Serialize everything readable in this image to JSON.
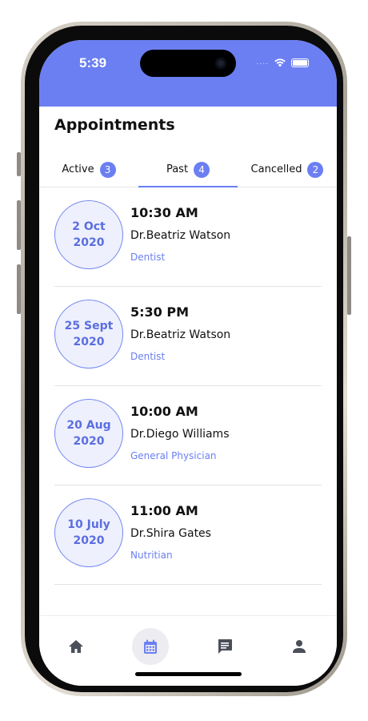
{
  "status_bar": {
    "time": "5:39",
    "background": "#6b7ff2",
    "signal": "...."
  },
  "page": {
    "title": "Appointments"
  },
  "tabs": [
    {
      "label": "Active",
      "count": "3",
      "selected": false
    },
    {
      "label": "Past",
      "count": "4",
      "selected": true
    },
    {
      "label": "Cancelled",
      "count": "2",
      "selected": false
    }
  ],
  "appointments": [
    {
      "date_day": "2 Oct",
      "date_year": "2020",
      "time": "10:30 AM",
      "doctor": "Dr.Beatriz Watson",
      "specialty": "Dentist"
    },
    {
      "date_day": "25 Sept",
      "date_year": "2020",
      "time": "5:30 PM",
      "doctor": "Dr.Beatriz Watson",
      "specialty": "Dentist"
    },
    {
      "date_day": "20 Aug",
      "date_year": "2020",
      "time": "10:00 AM",
      "doctor": "Dr.Diego Williams",
      "specialty": "General Physician"
    },
    {
      "date_day": "10 July",
      "date_year": "2020",
      "time": "11:00 AM",
      "doctor": "Dr.Shira Gates",
      "specialty": "Nutritian"
    }
  ],
  "bottom_nav": [
    {
      "icon": "home-icon",
      "active": false
    },
    {
      "icon": "calendar-icon",
      "active": true
    },
    {
      "icon": "chat-icon",
      "active": false
    },
    {
      "icon": "profile-icon",
      "active": false
    }
  ],
  "colors": {
    "accent": "#6b7ff2",
    "date_circle_bg": "#eef0fd",
    "nav_icon": "#4a4f5a"
  }
}
